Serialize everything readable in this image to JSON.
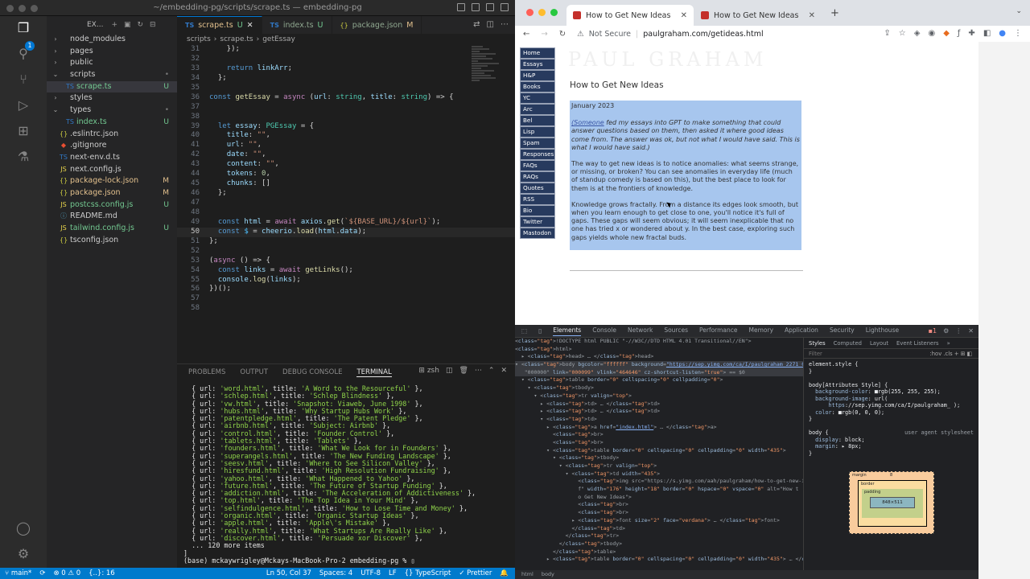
{
  "vscode": {
    "window_title": "~/embedding-pg/scripts/scrape.ts — embedding-pg",
    "explorer_label": "EX...",
    "tree": [
      {
        "label": "node_modules",
        "type": "folder",
        "depth": 0,
        "status": ""
      },
      {
        "label": "pages",
        "type": "folder",
        "depth": 0,
        "status": ""
      },
      {
        "label": "public",
        "type": "folder",
        "depth": 0,
        "status": ""
      },
      {
        "label": "scripts",
        "type": "folder-open",
        "depth": 0,
        "status": "•"
      },
      {
        "label": "scrape.ts",
        "type": "ts",
        "depth": 1,
        "status": "U"
      },
      {
        "label": "styles",
        "type": "folder",
        "depth": 0,
        "status": ""
      },
      {
        "label": "types",
        "type": "folder-open",
        "depth": 0,
        "status": "•"
      },
      {
        "label": "index.ts",
        "type": "ts",
        "depth": 1,
        "status": "U"
      },
      {
        "label": ".eslintrc.json",
        "type": "json",
        "depth": 0,
        "status": ""
      },
      {
        "label": ".gitignore",
        "type": "git",
        "depth": 0,
        "status": ""
      },
      {
        "label": "next-env.d.ts",
        "type": "ts",
        "depth": 0,
        "status": ""
      },
      {
        "label": "next.config.js",
        "type": "js",
        "depth": 0,
        "status": ""
      },
      {
        "label": "package-lock.json",
        "type": "json",
        "depth": 0,
        "status": "M"
      },
      {
        "label": "package.json",
        "type": "json",
        "depth": 0,
        "status": "M"
      },
      {
        "label": "postcss.config.js",
        "type": "js",
        "depth": 0,
        "status": "U"
      },
      {
        "label": "README.md",
        "type": "md",
        "depth": 0,
        "status": ""
      },
      {
        "label": "tailwind.config.js",
        "type": "js",
        "depth": 0,
        "status": "U"
      },
      {
        "label": "tsconfig.json",
        "type": "json",
        "depth": 0,
        "status": ""
      }
    ],
    "tabs": [
      {
        "label": "scrape.ts",
        "status": "U",
        "kind": "TS",
        "active": true
      },
      {
        "label": "index.ts",
        "status": "U",
        "kind": "TS",
        "active": false
      },
      {
        "label": "package.json",
        "status": "M",
        "kind": "{}",
        "active": false
      }
    ],
    "breadcrumb": [
      "scripts",
      "›",
      "scrape.ts",
      "›",
      "getEssay"
    ],
    "code_start_line": 31,
    "current_line": 50,
    "code_lines": [
      "    });",
      "",
      "    return linkArr;",
      "  };",
      "",
      "const getEssay = async (url: string, title: string) => {",
      "",
      "",
      "  let essay: PGEssay = {",
      "    title: \"\",",
      "    url: \"\",",
      "    date: \"\",",
      "    content: \"\",",
      "    tokens: 0,",
      "    chunks: []",
      "  };",
      "",
      "",
      "  const html = await axios.get(`${BASE_URL}/${url}`);",
      "  const $ = cheerio.load(html.data);",
      "};",
      "",
      "(async () => {",
      "  const links = await getLinks();",
      "  console.log(links);",
      "})();",
      "",
      ""
    ],
    "panel_tabs": [
      "PROBLEMS",
      "OUTPUT",
      "DEBUG CONSOLE",
      "TERMINAL"
    ],
    "active_panel_tab": "TERMINAL",
    "terminal_shell": "zsh",
    "terminal_lines": [
      [
        "word.html",
        "A Word to the Resourceful"
      ],
      [
        "schlep.html",
        "Schlep Blindness"
      ],
      [
        "vw.html",
        "Snapshot: Viaweb, June 1998"
      ],
      [
        "hubs.html",
        "Why Startup Hubs Work"
      ],
      [
        "patentpledge.html",
        "The Patent Pledge"
      ],
      [
        "airbnb.html",
        "Subject: Airbnb"
      ],
      [
        "control.html",
        "Founder Control"
      ],
      [
        "tablets.html",
        "Tablets"
      ],
      [
        "founders.html",
        "What We Look for in Founders"
      ],
      [
        "superangels.html",
        "The New Funding Landscape"
      ],
      [
        "seesv.html",
        "Where to See Silicon Valley"
      ],
      [
        "hiresfund.html",
        "High Resolution Fundraising"
      ],
      [
        "yahoo.html",
        "What Happened to Yahoo"
      ],
      [
        "future.html",
        "The Future of Startup Funding"
      ],
      [
        "addiction.html",
        "The Acceleration of Addictiveness"
      ],
      [
        "top.html",
        "The Top Idea in Your Mind"
      ],
      [
        "selfindulgence.html",
        "How to Lose Time and Money"
      ],
      [
        "organic.html",
        "Organic Startup Ideas"
      ],
      [
        "apple.html",
        "Apple's Mistake"
      ],
      [
        "really.html",
        "What Startups Are Really Like"
      ],
      [
        "discover.html",
        "Persuade xor Discover"
      ]
    ],
    "terminal_more": "... 120 more items",
    "terminal_close": "]",
    "terminal_prompt": "(base) mckaywrigley@Mckays-MacBook-Pro-2 embedding-pg % ",
    "status": {
      "branch": "main*",
      "problems": "⊗ 0 ⚠ 0",
      "extra": "{..}: 16",
      "position": "Ln 50, Col 37",
      "spaces": "Spaces: 4",
      "encoding": "UTF-8",
      "eol": "LF",
      "language": "{} TypeScript",
      "prettier": "✓ Prettier"
    }
  },
  "chrome": {
    "tabs": [
      {
        "label": "How to Get New Ideas",
        "active": true
      },
      {
        "label": "How to Get New Ideas",
        "active": false
      }
    ],
    "not_secure": "Not Secure",
    "url": "paulgraham.com/getideas.html",
    "page": {
      "nav": [
        "Home",
        "Essays",
        "H&P",
        "Books",
        "YC",
        "Arc",
        "Bel",
        "Lisp",
        "Spam",
        "Responses",
        "FAQs",
        "RAQs",
        "Quotes",
        "RSS",
        "Bio",
        "Twitter",
        "Mastodon"
      ],
      "logo": "PAUL GRAHAM",
      "title": "How to Get New Ideas",
      "date": "January 2023",
      "intro_link": "(Someone",
      "intro_rest": " fed my essays into GPT to make something that could answer questions based on them, then asked it where good ideas come from. The answer was ok, but not what I would have said. This is what I would have said.)",
      "p1": "The way to get new ideas is to notice anomalies: what seems strange, or missing, or broken? You can see anomalies in everyday life (much of standup comedy is based on this), but the best place to look for them is at the frontiers of knowledge.",
      "p2": "Knowledge grows fractally. From a distance its edges look smooth, but when you learn enough to get close to one, you'll notice it's full of gaps. These gaps will seem obvious; it will seem inexplicable that no one has tried x or wondered about y. In the best case, exploring such gaps yields whole new fractal buds."
    },
    "devtools": {
      "tabs": [
        "Elements",
        "Console",
        "Network",
        "Sources",
        "Performance",
        "Memory",
        "Application",
        "Security",
        "Lighthouse"
      ],
      "active_tab": "Elements",
      "badge": "1",
      "dom_lines": [
        "<!DOCTYPE html PUBLIC \"-//W3C//DTD HTML 4.01 Transitional//EN\">",
        "<html>",
        "  ▸ <head> … </head>",
        "▾ <body bgcolor=\"ffffff\" background=\"https://sep.yimg.com/ca/I/paulgraham_2271_0\" text=",
        "   \"000000\" link=\"000099\" vlink=\"464646\" cz-shortcut-listen=\"true\"> == $0",
        "  ▾ <table border=\"0\" cellspacing=\"0\" cellpadding=\"0\">",
        "    ▾ <tbody>",
        "      ▾ <tr valign=\"top\">",
        "        ▸ <td> … </td>",
        "        ▸ <td> … </td>",
        "        ▾ <td>",
        "          ▸ <a href=\"index.html\"> … </a>",
        "            <br>",
        "            <br>",
        "          ▾ <table border=\"0\" cellspacing=\"0\" cellpadding=\"0\" width=\"435\">",
        "            ▾ <tbody>",
        "              ▾ <tr valign=\"top\">",
        "                ▾ <td width=\"435\">",
        "                    <img src=\"https://s.yimg.com/aah/paulgraham/how-to-get-new-ideas-1.gi",
        "                    f\" width=\"176\" height=\"18\" border=\"0\" hspace=\"0\" vspace=\"0\" alt=\"How t",
        "                    o Get New Ideas\">",
        "                    <br>",
        "                    <br>",
        "                  ▸ <font size=\"2\" face=\"verdana\"> … </font>",
        "                  </td>",
        "                </tr>",
        "              </tbody>",
        "            </table>",
        "          ▸ <table border=\"0\" cellspacing=\"0\" cellpadding=\"0\" width=\"435\"> … </table>"
      ],
      "crumbs": [
        "html",
        "body"
      ],
      "styles_tabs": [
        "Styles",
        "Computed",
        "Layout",
        "Event Listeners",
        "»"
      ],
      "filter_placeholder": "Filter",
      "filter_right": ":hov .cls + ⊞ ◧",
      "style_lines": [
        "element.style {",
        "}",
        "",
        "body[Attributes Style] {",
        "  background-color: ■rgb(255, 255, 255);",
        "  background-image: url(",
        "      https://sep.yimg.com/ca/I/paulgraham_ );",
        "  color: ■rgb(0, 0, 0);",
        "}",
        "",
        "body {                        user agent stylesheet",
        "  display: block;",
        "  margin: ▸ 8px;",
        "}"
      ],
      "box": {
        "margin": "margin",
        "border": "border",
        "padding": "padding",
        "content": "848×511",
        "m_val": "8"
      }
    }
  }
}
